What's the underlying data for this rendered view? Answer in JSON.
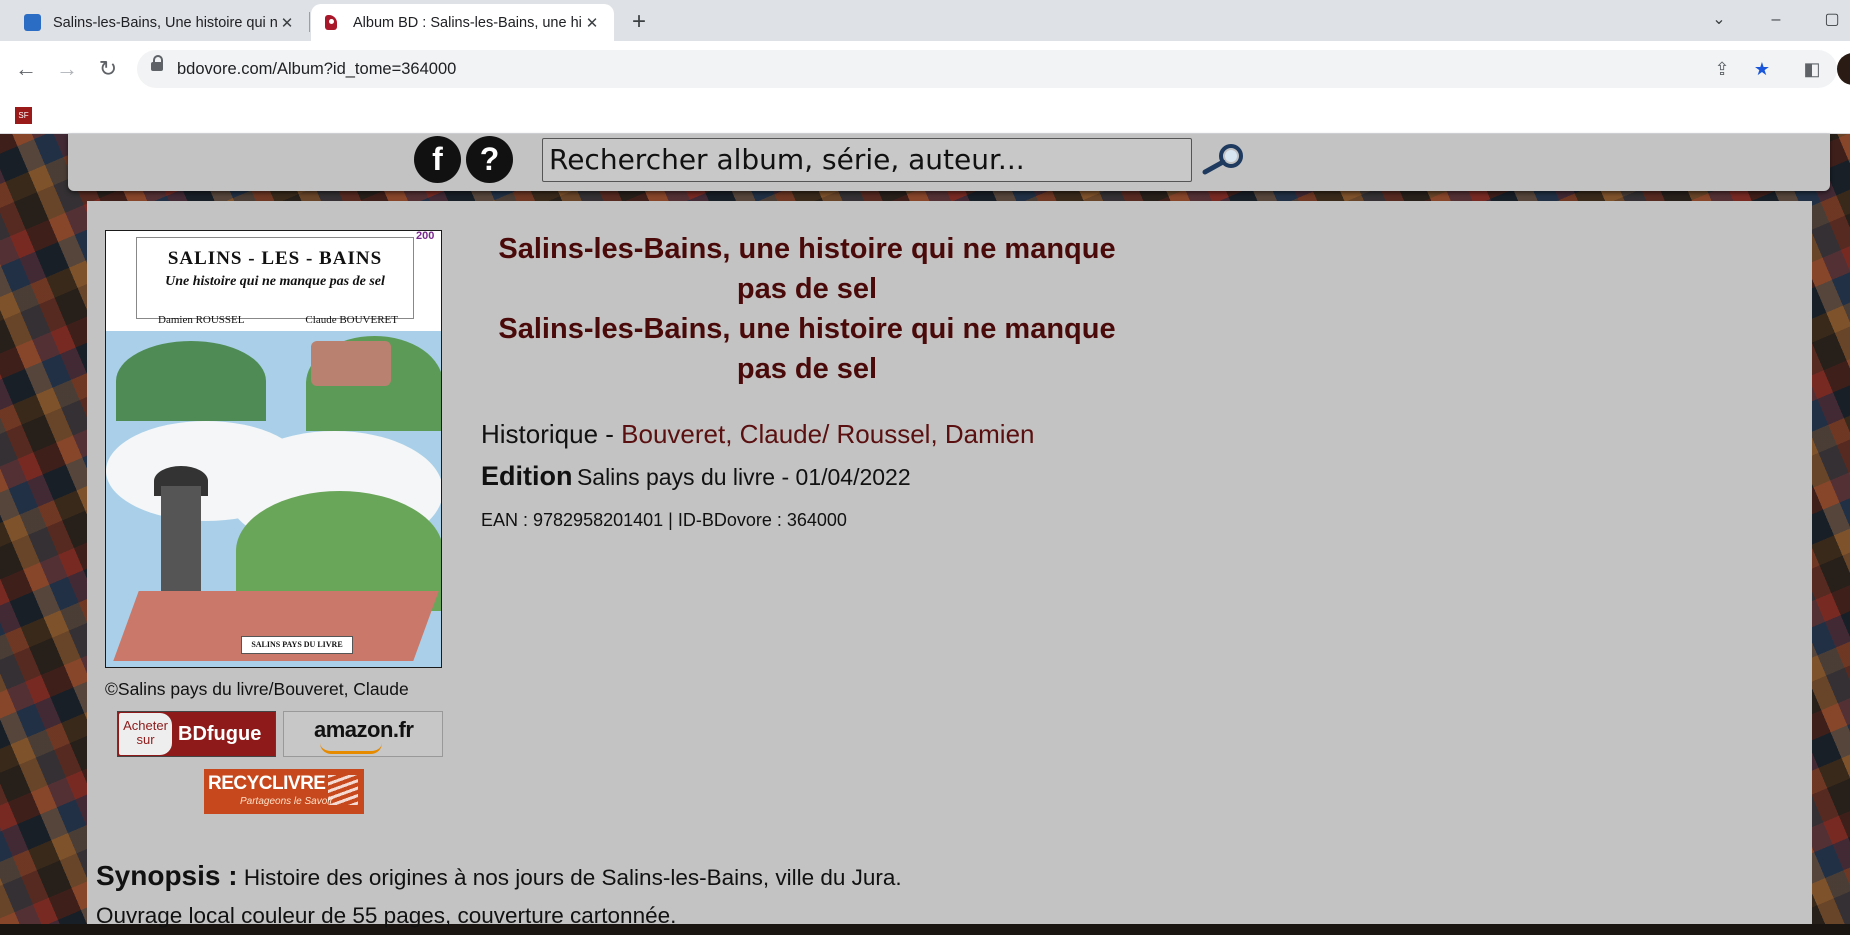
{
  "browser": {
    "tabs": [
      {
        "title": "Salins-les-Bains, Une histoire qui ne manque pas de sel",
        "close": "✕",
        "favicon": "document-icon"
      },
      {
        "title": "Album BD : Salins-les-Bains, une histoire qui ne manque pas de sel",
        "close": "✕",
        "favicon": "bdovore-icon"
      }
    ],
    "new_tab": "+",
    "url": "bdovore.com/Album?id_tome=364000",
    "bookmark_favicon_text": "SF"
  },
  "site_header": {
    "facebook_label": "f",
    "help_label": "?",
    "search_placeholder": "Rechercher album, série, auteur..."
  },
  "album": {
    "title_line": "Salins-les-Bains, une histoire qui ne manque pas de sel",
    "title_line_repeat": "Salins-les-Bains, une histoire qui ne manque pas de sel",
    "genre": "Historique",
    "genre_sep": " - ",
    "authors": "Bouveret, Claude/ Roussel, Damien",
    "edition_label": "Edition",
    "edition_value": "Salins pays du livre - 01/04/2022",
    "ids": "EAN : 9782958201401 | ID-BDovore : 364000",
    "copyright": "©Salins pays du livre/Bouveret, Claude",
    "cover": {
      "title": "SALINS - LES - BAINS",
      "subtitle": "Une histoire qui ne manque pas de sel",
      "author_left": "Damien ROUSSEL",
      "author_right": "Claude BOUVERET",
      "year": "200",
      "label": "SALINS PAYS DU LIVRE"
    }
  },
  "shops": {
    "bdfugue_small": "Acheter sur",
    "bdfugue_brand": "BDfugue",
    "amazon_brand": "amazon.fr",
    "recyclivre_brand": "RECYCLIVRE",
    "recyclivre_tag": "Partageons le Savoir"
  },
  "synopsis": {
    "label": "Synopsis :",
    "line1": "Histoire des origines à nos jours de Salins-les-Bains, ville du Jura.",
    "line2": "Ouvrage local couleur de 55 pages, couverture cartonnée."
  },
  "colors": {
    "title": "#4a0a0a",
    "panel": "#c3c3c3",
    "bdfugue": "#8e1a1a",
    "recyclivre": "#c6481c",
    "bookmark_star": "#1a56db"
  }
}
